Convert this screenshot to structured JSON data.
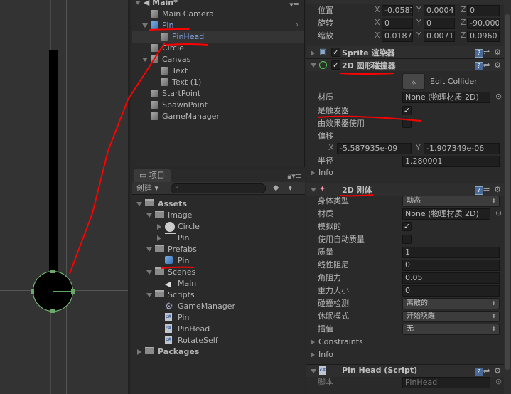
{
  "hierarchy": {
    "scene": "Main*",
    "items": [
      {
        "label": "Main Camera",
        "depth": 1,
        "icon": "gameobject-icon"
      },
      {
        "label": "Pin",
        "depth": 1,
        "icon": "prefab-icon",
        "expanded": true,
        "prefab": true
      },
      {
        "label": "PinHead",
        "depth": 2,
        "icon": "gameobject-icon",
        "selected": true,
        "prefab": true
      },
      {
        "label": "Circle",
        "depth": 1,
        "icon": "gameobject-icon"
      },
      {
        "label": "Canvas",
        "depth": 1,
        "icon": "gameobject-icon",
        "expanded": true
      },
      {
        "label": "Text",
        "depth": 2,
        "icon": "gameobject-icon"
      },
      {
        "label": "Text (1)",
        "depth": 2,
        "icon": "gameobject-icon"
      },
      {
        "label": "StartPoint",
        "depth": 1,
        "icon": "gameobject-icon"
      },
      {
        "label": "SpawnPoint",
        "depth": 1,
        "icon": "gameobject-icon"
      },
      {
        "label": "GameManager",
        "depth": 1,
        "icon": "gameobject-icon"
      }
    ]
  },
  "project": {
    "tab": "项目",
    "create": "创建",
    "search_placeholder": "",
    "items": [
      {
        "label": "Assets",
        "depth": 0,
        "icon": "folder-icon",
        "expanded": true,
        "bold": true
      },
      {
        "label": "Image",
        "depth": 1,
        "icon": "folder-icon",
        "expanded": true
      },
      {
        "label": "Circle",
        "depth": 2,
        "icon": "sprite-circle-icon",
        "collapsed": true
      },
      {
        "label": "Pin",
        "depth": 2,
        "icon": "sprite-line-icon",
        "collapsed": true
      },
      {
        "label": "Prefabs",
        "depth": 1,
        "icon": "folder-icon",
        "expanded": true
      },
      {
        "label": "Pin",
        "depth": 2,
        "icon": "prefab-icon"
      },
      {
        "label": "Scenes",
        "depth": 1,
        "icon": "folder-icon",
        "expanded": true
      },
      {
        "label": "Main",
        "depth": 2,
        "icon": "unity-scene-icon"
      },
      {
        "label": "Scripts",
        "depth": 1,
        "icon": "folder-icon",
        "expanded": true
      },
      {
        "label": "GameManager",
        "depth": 2,
        "icon": "gear-icon"
      },
      {
        "label": "Pin",
        "depth": 2,
        "icon": "csharp-icon"
      },
      {
        "label": "PinHead",
        "depth": 2,
        "icon": "csharp-icon"
      },
      {
        "label": "RotateSelf",
        "depth": 2,
        "icon": "csharp-icon"
      },
      {
        "label": "Packages",
        "depth": 0,
        "icon": "folder-icon",
        "collapsed": true,
        "bold": true
      }
    ]
  },
  "inspector": {
    "transform": {
      "position": {
        "label": "位置",
        "x": "-0.0587",
        "y": "0.0004",
        "z": "0"
      },
      "rotation": {
        "label": "旋转",
        "x": "0",
        "y": "0",
        "z": "-90.000"
      },
      "scale": {
        "label": "缩放",
        "x": "0.0187",
        "y": "0.0071",
        "z": "0.0960"
      }
    },
    "sprite_renderer": {
      "title": "Sprite 渲染器",
      "enabled": true
    },
    "circle_collider": {
      "title": "2D 圆形碰撞器",
      "enabled": true,
      "edit_collider": "Edit Collider",
      "material_label": "材质",
      "material": "None (物理材质 2D)",
      "trigger_label": "是触发器",
      "is_trigger": true,
      "effector_label": "由效果器使用",
      "used_by_effector": false,
      "offset_label": "偏移",
      "offset_x": "-5.587935e-09",
      "offset_y": "-1.907349e-06",
      "radius_label": "半径",
      "radius": "1.280001",
      "info": "Info"
    },
    "rigidbody": {
      "title": "2D 刚体",
      "body_type_label": "身体类型",
      "body_type": "动态",
      "material_label": "材质",
      "material": "None (物理材质 2D)",
      "simulated_label": "模拟的",
      "simulated": true,
      "auto_mass_label": "使用自动质量",
      "auto_mass": false,
      "mass_label": "质量",
      "mass": "1",
      "linear_drag_label": "线性阻尼",
      "linear_drag": "0",
      "angular_drag_label": "角阻力",
      "angular_drag": "0.05",
      "gravity_label": "重力大小",
      "gravity": "0",
      "collision_label": "碰撞检测",
      "collision": "离散的",
      "sleep_label": "休眠模式",
      "sleep": "开始唤醒",
      "interp_label": "插值",
      "interp": "无",
      "constraints": "Constraints",
      "info": "Info"
    },
    "script": {
      "title": "Pin Head (Script)",
      "script_label": "脚本",
      "script": "PinHead"
    }
  },
  "colors": {
    "annotation": "#ff0000",
    "collider": "#7fd07f",
    "selected_row": "#343434",
    "prefab_text": "#7f9fdf"
  }
}
